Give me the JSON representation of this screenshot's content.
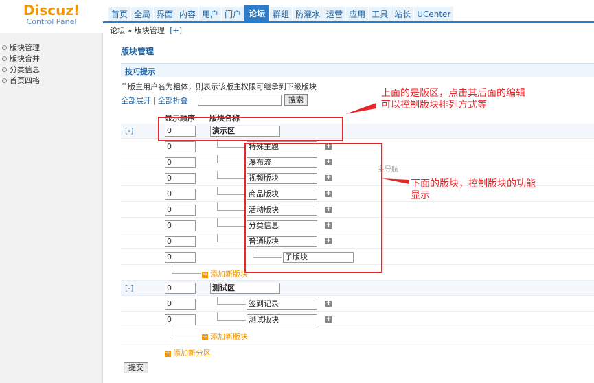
{
  "logo": {
    "main": "Discuz!",
    "sub": "Control Panel"
  },
  "nav": [
    {
      "label": "首页",
      "active": false
    },
    {
      "label": "全局",
      "active": false
    },
    {
      "label": "界面",
      "active": false
    },
    {
      "label": "内容",
      "active": false
    },
    {
      "label": "用户",
      "active": false
    },
    {
      "label": "门户",
      "active": false
    },
    {
      "label": "论坛",
      "active": true
    },
    {
      "label": "群组",
      "active": false
    },
    {
      "label": "防灌水",
      "active": false
    },
    {
      "label": "运营",
      "active": false
    },
    {
      "label": "应用",
      "active": false
    },
    {
      "label": "工具",
      "active": false
    },
    {
      "label": "站长",
      "active": false
    },
    {
      "label": "UCenter",
      "active": false
    }
  ],
  "breadcrumb": {
    "root": "论坛",
    "sep": "»",
    "current": "版块管理",
    "plus": "[+]"
  },
  "sidebar": {
    "items": [
      "版块管理",
      "版块合并",
      "分类信息",
      "首页四格"
    ]
  },
  "page": {
    "title": "版块管理",
    "tips_title": "技巧提示",
    "tips_star": "*",
    "tips_text": "版主用户名为粗体，则表示该版主权限可继承到下级版块",
    "expand_all": "全部展开",
    "toolbar_sep": "|",
    "collapse_all": "全部折叠",
    "search_button": "搜索",
    "col_order": "显示顺序",
    "col_name": "版块名称",
    "collapse_label": "[-]",
    "add_forum": "添加新版块",
    "add_category": "添加新分区",
    "add_icon": "+",
    "side_note": "主导航",
    "submit": "提交"
  },
  "groups": [
    {
      "order": "0",
      "name": "演示区",
      "forums": [
        {
          "order": "0",
          "name": "特殊主题"
        },
        {
          "order": "0",
          "name": "瀑布流"
        },
        {
          "order": "0",
          "name": "视频版块"
        },
        {
          "order": "0",
          "name": "商品版块"
        },
        {
          "order": "0",
          "name": "活动版块"
        },
        {
          "order": "0",
          "name": "分类信息"
        },
        {
          "order": "0",
          "name": "普通版块"
        }
      ],
      "subforum": {
        "order": "0",
        "name": "子版块"
      }
    },
    {
      "order": "0",
      "name": "测试区",
      "forums": [
        {
          "order": "0",
          "name": "签到记录"
        },
        {
          "order": "0",
          "name": "测试版块"
        }
      ]
    }
  ],
  "annotations": {
    "top_line1": "上面的是版区，点击其后面的编辑",
    "top_line2": "可以控制版块排列方式等",
    "bottom_line1": "下面的版块，控制版块的功能",
    "bottom_line2": "显示",
    "color": "#e5262b"
  },
  "colors": {
    "brand": "#f39800",
    "nav_active": "#2d7cc9",
    "link": "#2466a5"
  }
}
